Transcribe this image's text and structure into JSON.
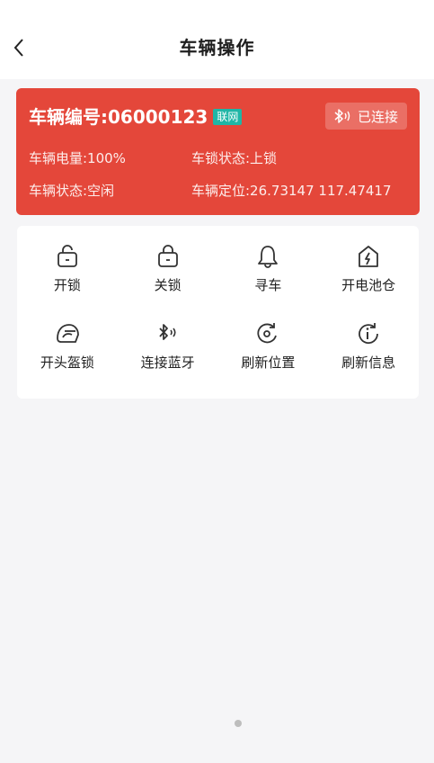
{
  "nav": {
    "title": "车辆操作"
  },
  "vehicle": {
    "number_label": "车辆编号:06000123",
    "net_tag": "联网",
    "bluetooth_status": "已连接",
    "battery": "车辆电量:100%",
    "lock_status": "车锁状态:上锁",
    "status": "车辆状态:空闲",
    "location": "车辆定位:26.73147 117.47417"
  },
  "actions": [
    {
      "label": "开锁",
      "icon": "unlock-icon"
    },
    {
      "label": "关锁",
      "icon": "lock-icon"
    },
    {
      "label": "寻车",
      "icon": "bell-icon"
    },
    {
      "label": "开电池仓",
      "icon": "battery-box-icon"
    },
    {
      "label": "开头盔锁",
      "icon": "helmet-icon"
    },
    {
      "label": "连接蓝牙",
      "icon": "bluetooth-icon"
    },
    {
      "label": "刷新位置",
      "icon": "location-refresh-icon"
    },
    {
      "label": "刷新信息",
      "icon": "info-refresh-icon"
    }
  ],
  "colors": {
    "card_bg": "#e4473a",
    "tag_bg": "#1fb6a6"
  }
}
